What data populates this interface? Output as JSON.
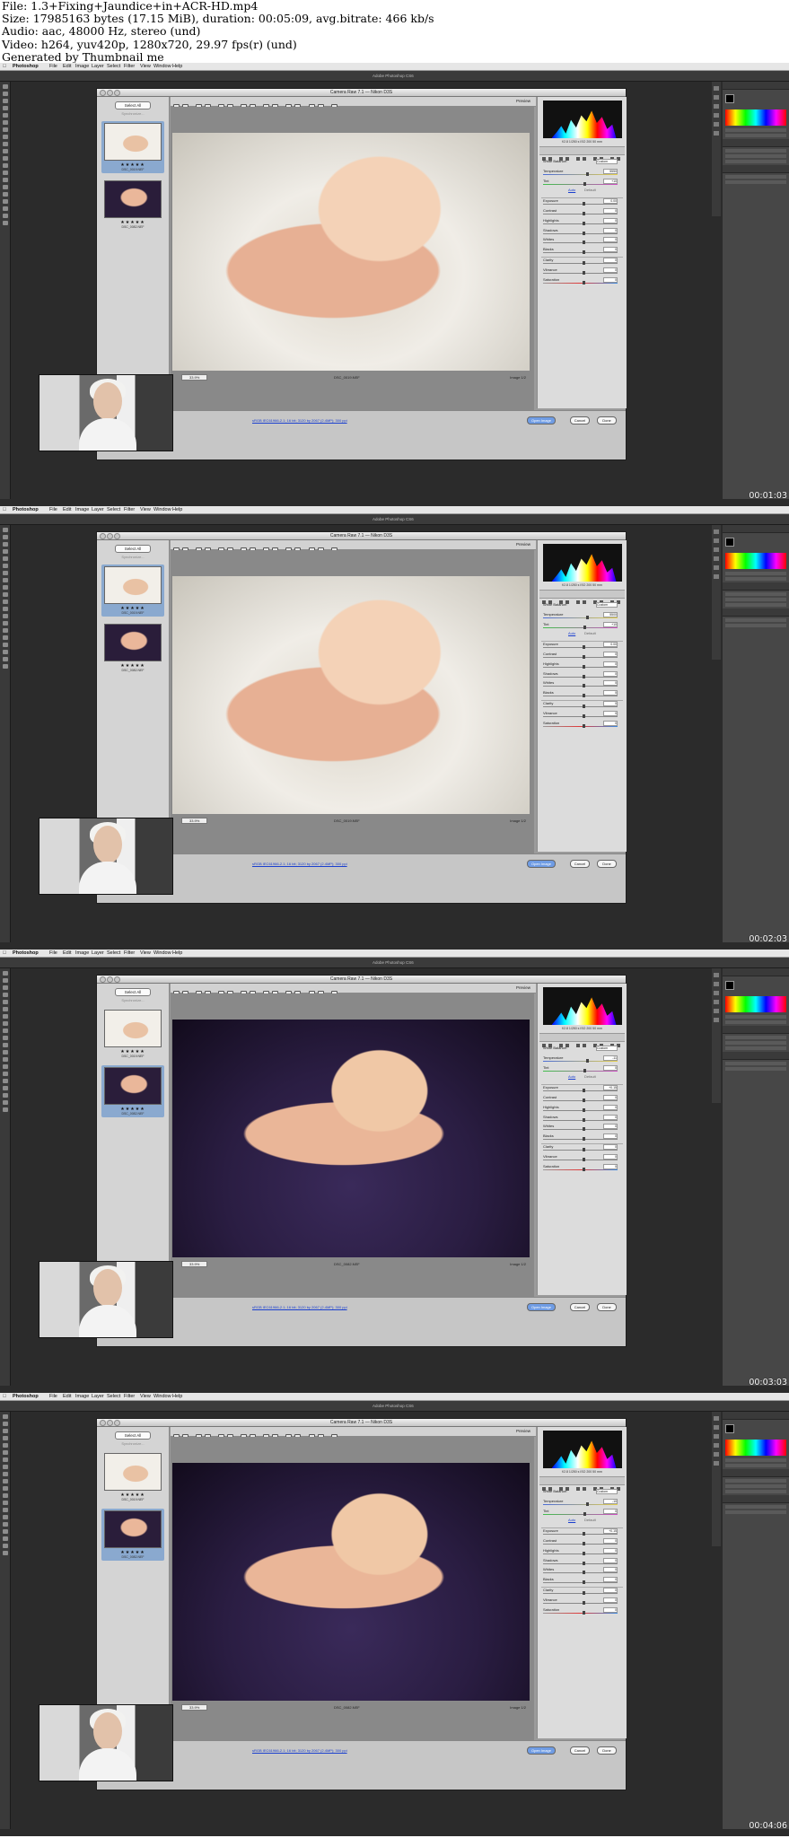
{
  "header": {
    "line1": "File: 1.3+Fixing+Jaundice+in+ACR-HD.mp4",
    "line2": "Size: 17985163 bytes (17.15 MiB), duration: 00:05:09, avg.bitrate: 466 kb/s",
    "line3": "Audio: aac, 48000 Hz, stereo (und)",
    "line4": "Video: h264, yuv420p, 1280x720, 29.97 fps(r) (und)",
    "line5": "Generated by Thumbnail me"
  },
  "app": {
    "name": "Photoshop",
    "menus": [
      "File",
      "Edit",
      "Image",
      "Layer",
      "Select",
      "Filter",
      "View",
      "Window",
      "Help"
    ],
    "window_title": "Adobe Photoshop CS6"
  },
  "dialog": {
    "title": "Camera Raw 7.1 — Nikon D3S",
    "preview_label": "Preview",
    "select_all": "Select All",
    "synchronize": "Synchronize...",
    "stars": "★★★★★",
    "thumb1_name": "DSC_0019.NEF",
    "thumb2_name": "DSC_0082.NEF",
    "zoom": "33.9%",
    "image_count": "Image 1/2",
    "workflow_link": "sRGB IEC61966-2.1; 16 bit; 3120 by 2067 (2.4MP); 300 ppi",
    "open_image": "Open Image",
    "cancel": "Cancel",
    "done": "Done",
    "histo_caption": "f/2.8  1/250 s  ISO 200  50 mm",
    "white_balance": "White Balance:",
    "wb_value": "Custom",
    "auto": "Auto",
    "default": "Default"
  },
  "sliders": {
    "temperature": "Temperature",
    "tint": "Tint",
    "exposure": "Exposure",
    "contrast": "Contrast",
    "highlights": "Highlights",
    "shadows": "Shadows",
    "whites": "Whites",
    "blacks": "Blacks",
    "clarity": "Clarity",
    "vibrance": "Vibrance",
    "saturation": "Saturation"
  },
  "frames": [
    {
      "timestamp": "00:01:03",
      "temp_value": "5550",
      "tint_value": "+10",
      "exposure_value": "0.00"
    },
    {
      "timestamp": "00:02:03",
      "temp_value": "5500",
      "tint_value": "+10",
      "exposure_value": "0.00"
    },
    {
      "timestamp": "00:03:03",
      "temp_value": "-11",
      "tint_value": "0",
      "exposure_value": "+0.15"
    },
    {
      "timestamp": "00:04:06",
      "temp_value": "-10",
      "tint_value": "0",
      "exposure_value": "+0.15"
    }
  ],
  "colors": {
    "background": "#2b2b2b",
    "dialog": "#9b9b9b",
    "accent": "#6f9ce4"
  }
}
